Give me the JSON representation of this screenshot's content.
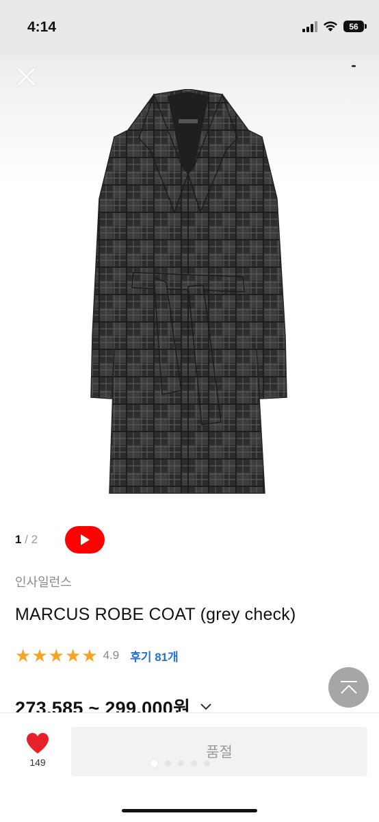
{
  "status_bar": {
    "time": "4:14",
    "battery": "56"
  },
  "gallery": {
    "current_page": "1",
    "separator": " / ",
    "total_pages": "2"
  },
  "product": {
    "brand": "인사일런스",
    "title": "MARCUS ROBE COAT (grey check)",
    "rating": "4.9",
    "stars": 5,
    "reviews": "후기 81개",
    "price": "273,585 ~ 299,000원"
  },
  "bottom_bar": {
    "like_count": "149",
    "soldout_label": "품절"
  },
  "colors": {
    "star": "#f7a325",
    "review_link": "#2070d8",
    "youtube": "#ff0000",
    "like_heart": "#e8202a"
  },
  "icons": [
    "close-icon",
    "youtube-play-icon",
    "star-icon",
    "chevron-down-icon",
    "scroll-top-icon",
    "heart-icon",
    "wifi-icon",
    "signal-icon",
    "battery-icon"
  ]
}
